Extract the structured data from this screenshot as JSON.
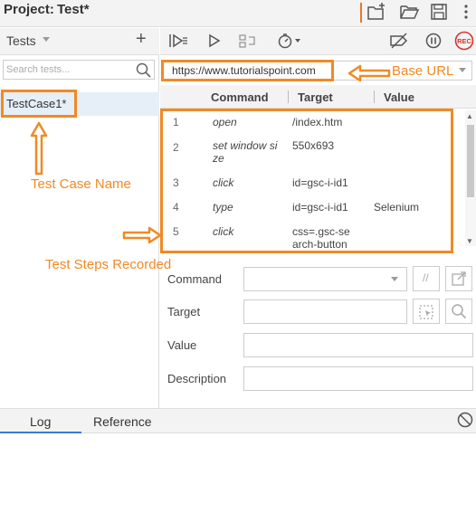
{
  "project": {
    "label": "Project:",
    "name": "Test*"
  },
  "tests_panel": {
    "title": "Tests",
    "add_label": "+",
    "search_placeholder": "Search tests...",
    "test_cases": [
      "TestCase1*"
    ]
  },
  "base_url": "https://www.tutorialspoint.com",
  "grid": {
    "headers": {
      "command": "Command",
      "target": "Target",
      "value": "Value"
    },
    "rows": [
      {
        "num": "1",
        "command": "open",
        "target": "/index.htm",
        "value": ""
      },
      {
        "num": "2",
        "command_line1": "set window si",
        "command_line2": "ze",
        "target": "550x693",
        "value": ""
      },
      {
        "num": "3",
        "command": "click",
        "target": "id=gsc-i-id1",
        "value": ""
      },
      {
        "num": "4",
        "command": "type",
        "target": "id=gsc-i-id1",
        "value": "Selenium"
      },
      {
        "num": "5",
        "command": "click",
        "target_line1": "css=.gsc-se",
        "target_line2": "arch-button",
        "value": ""
      }
    ]
  },
  "form": {
    "command_label": "Command",
    "target_label": "Target",
    "value_label": "Value",
    "description_label": "Description",
    "comment_btn": "//"
  },
  "annotations": {
    "base_url": "Base URL",
    "test_case_name": "Test Case Name",
    "test_steps": "Test Steps Recorded"
  },
  "bottom_tabs": {
    "log": "Log",
    "reference": "Reference"
  },
  "rec_label": "REC",
  "colors": {
    "annotation": "#f08a24",
    "selection": "#e6eef8",
    "rec": "#d9342b",
    "tab_underline": "#3a7bd5"
  }
}
